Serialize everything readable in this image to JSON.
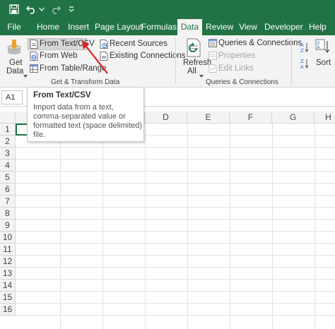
{
  "quick_access": {
    "save_icon": "save-icon",
    "undo_icon": "undo-icon",
    "undo_dropdown_icon": "chevron-down-icon",
    "redo_icon": "redo-icon",
    "customize_icon": "customize-quick-access-icon"
  },
  "tabs": [
    {
      "label": "File"
    },
    {
      "label": "Home"
    },
    {
      "label": "Insert"
    },
    {
      "label": "Page Layout"
    },
    {
      "label": "Formulas"
    },
    {
      "label": "Data"
    },
    {
      "label": "Review"
    },
    {
      "label": "View"
    },
    {
      "label": "Developer"
    },
    {
      "label": "Help"
    }
  ],
  "active_tab": "Data",
  "ribbon": {
    "get_data": {
      "label_line1": "Get",
      "label_line2": "Data"
    },
    "from_text_csv": "From Text/CSV",
    "from_web": "From Web",
    "from_table_range": "From Table/Range",
    "recent_sources": "Recent Sources",
    "existing_connections": "Existing Connections",
    "group_get_transform": "Get & Transform Data",
    "refresh_all": {
      "label_line1": "Refresh",
      "label_line2": "All"
    },
    "queries_connections": "Queries & Connections",
    "properties": "Properties",
    "edit_links": "Edit Links",
    "group_queries": "Queries & Connections",
    "sort": "Sort"
  },
  "formula_bar": {
    "name_box": "A1"
  },
  "tooltip": {
    "title": "From Text/CSV",
    "line1": "Import data from a text,",
    "line2": "comma-separated value or",
    "line3": "formatted text (space delimited)",
    "line4": "file."
  },
  "columns": [
    "D",
    "E",
    "F",
    "G",
    "H"
  ],
  "rows": [
    "1",
    "2",
    "3",
    "4",
    "5",
    "6",
    "7",
    "8",
    "9",
    "10",
    "11",
    "12",
    "13",
    "14",
    "15",
    "16"
  ],
  "colors": {
    "excel_green": "#217346",
    "annotation_arrow": "#e02020"
  }
}
